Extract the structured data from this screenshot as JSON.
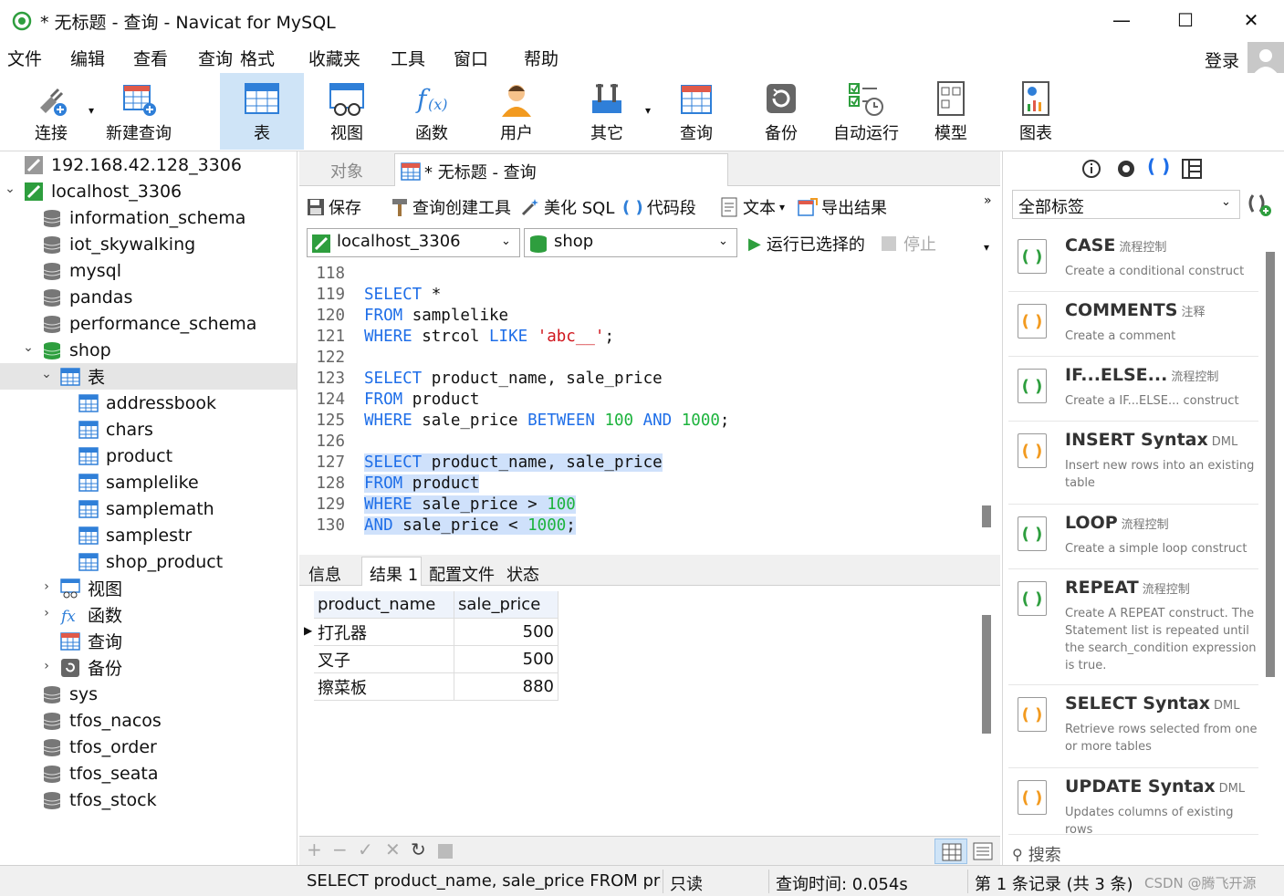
{
  "window": {
    "title": "* 无标题 - 查询 - Navicat for MySQL"
  },
  "menu": [
    "文件",
    "编辑",
    "查看",
    "查询",
    "格式",
    "收藏夹",
    "工具",
    "窗口",
    "帮助"
  ],
  "login_label": "登录",
  "toolbar": {
    "connect": "连接",
    "new_query": "新建查询",
    "table": "表",
    "view": "视图",
    "function": "函数",
    "user": "用户",
    "other": "其它",
    "query": "查询",
    "backup": "备份",
    "autorun": "自动运行",
    "model": "模型",
    "chart": "图表"
  },
  "tree": {
    "items": [
      "192.168.42.128_3306",
      "localhost_3306",
      "information_schema",
      "iot_skywalking",
      "mysql",
      "pandas",
      "performance_schema",
      "shop",
      "表",
      "addressbook",
      "chars",
      "product",
      "samplelike",
      "samplemath",
      "samplestr",
      "shop_product",
      "视图",
      "函数",
      "查询",
      "备份",
      "sys",
      "tfos_nacos",
      "tfos_order",
      "tfos_seata",
      "tfos_stock"
    ]
  },
  "tabs": {
    "object": "对象",
    "query_tab": "* 无标题 - 查询"
  },
  "editor_toolbar": {
    "save": "保存",
    "builder": "查询创建工具",
    "beautify": "美化 SQL",
    "snippet": "代码段",
    "text": "文本",
    "export": "导出结果"
  },
  "connection_select": "localhost_3306",
  "database_select": "shop",
  "run_selected": "运行已选择的",
  "stop": "停止",
  "code_lines": [
    {
      "n": "118",
      "t": ""
    },
    {
      "n": "119",
      "t": "SELECT *"
    },
    {
      "n": "120",
      "t": "FROM samplelike"
    },
    {
      "n": "121",
      "t": "WHERE strcol LIKE 'abc__';"
    },
    {
      "n": "122",
      "t": ""
    },
    {
      "n": "123",
      "t": "SELECT product_name, sale_price"
    },
    {
      "n": "124",
      "t": "FROM product"
    },
    {
      "n": "125",
      "t": "WHERE sale_price BETWEEN 100 AND 1000;"
    },
    {
      "n": "126",
      "t": ""
    },
    {
      "n": "127",
      "t": "SELECT product_name, sale_price"
    },
    {
      "n": "128",
      "t": "FROM product"
    },
    {
      "n": "129",
      "t": "WHERE sale_price > 100"
    },
    {
      "n": "130",
      "t": "AND sale_price < 1000;"
    }
  ],
  "result_tabs": [
    "信息",
    "结果 1",
    "配置文件",
    "状态"
  ],
  "result": {
    "columns": [
      "product_name",
      "sale_price"
    ],
    "rows": [
      [
        "打孔器",
        "500"
      ],
      [
        "叉子",
        "500"
      ],
      [
        "擦菜板",
        "880"
      ]
    ]
  },
  "right_panel": {
    "tag_select": "全部标签",
    "search_placeholder": "搜索",
    "snippets": [
      {
        "title": "CASE",
        "tag": "流程控制",
        "desc": "Create a conditional construct"
      },
      {
        "title": "COMMENTS",
        "tag": "注释",
        "desc": "Create a comment"
      },
      {
        "title": "IF...ELSE...",
        "tag": "流程控制",
        "desc": "Create a IF...ELSE... construct"
      },
      {
        "title": "INSERT Syntax",
        "tag": "DML",
        "desc": "Insert new rows into an existing table"
      },
      {
        "title": "LOOP",
        "tag": "流程控制",
        "desc": "Create a simple loop construct"
      },
      {
        "title": "REPEAT",
        "tag": "流程控制",
        "desc": "Create A REPEAT construct. The Statement list is repeated until the search_condition expression is true."
      },
      {
        "title": "SELECT Syntax",
        "tag": "DML",
        "desc": "Retrieve rows selected from one or more tables"
      },
      {
        "title": "UPDATE Syntax",
        "tag": "DML",
        "desc": "Updates columns of existing rows"
      }
    ]
  },
  "status": {
    "sql": "SELECT product_name, sale_price FROM proc",
    "readonly": "只读",
    "query_time": "查询时间: 0.054s",
    "records": "第 1 条记录 (共 3 条)",
    "watermark": "CSDN @腾飞开源"
  },
  "colors": {
    "accent": "#1e6ee8",
    "number": "#1db33d",
    "string": "#d0161d",
    "selection": "#cfe1fb",
    "active_tool": "#cfe4f7"
  }
}
